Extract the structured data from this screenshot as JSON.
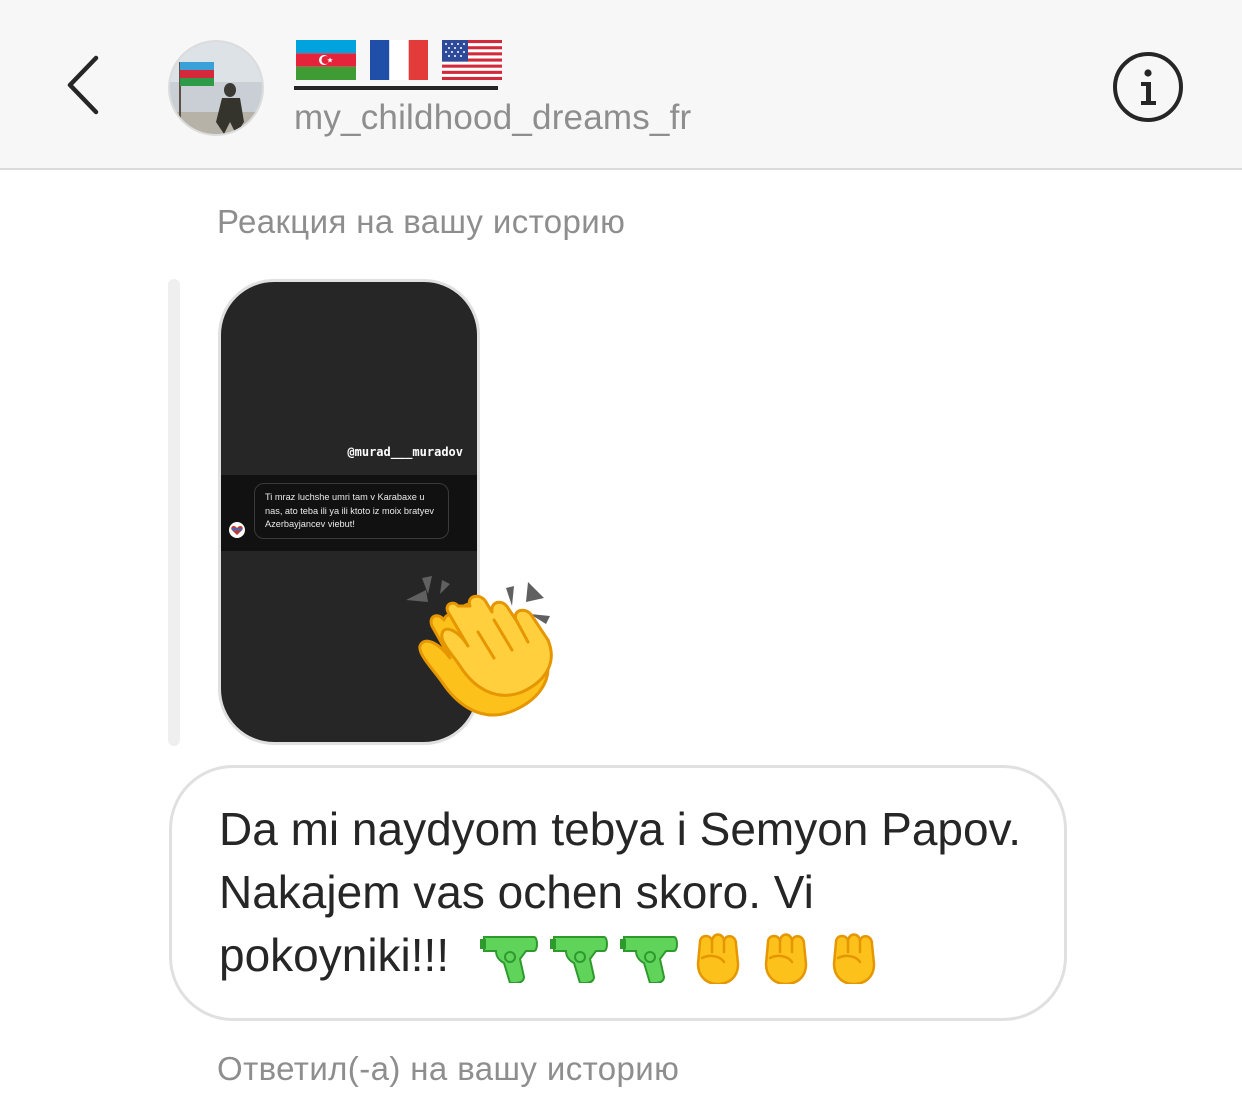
{
  "header": {
    "username": "my_childhood_dreams_fr",
    "flags": [
      "azerbaijan-flag",
      "france-flag",
      "usa-flag"
    ],
    "back_icon": "chevron-left-icon",
    "info_icon": "info-icon"
  },
  "thread": {
    "reaction_label": "Реакция на вашу историю",
    "story": {
      "mention": "@murad___muradov",
      "dm_text": "Ti mraz luchshe umri tam v Karabaxe u nas, ato teba ili ya ili ktoto iz moix bratyev Azerbayjancev viebut!",
      "reaction_icon": "clapping-hands-icon"
    },
    "message": {
      "text": "Da mi naydyom tebya i Semyon Papov.  Nakajem vas ochen skoro. Vi pokoyniki!!!",
      "emojis": [
        "water-pistol-icon",
        "water-pistol-icon",
        "water-pistol-icon",
        "raised-fist-icon",
        "raised-fist-icon",
        "raised-fist-icon"
      ]
    },
    "replied_label": "Ответил(-а) на вашу историю"
  },
  "colors": {
    "header_bg": "#f7f7f7",
    "secondary_text": "#8e8e8e",
    "primary_text": "#262626",
    "border": "#e0e0e0",
    "story_bg": "#262626"
  }
}
